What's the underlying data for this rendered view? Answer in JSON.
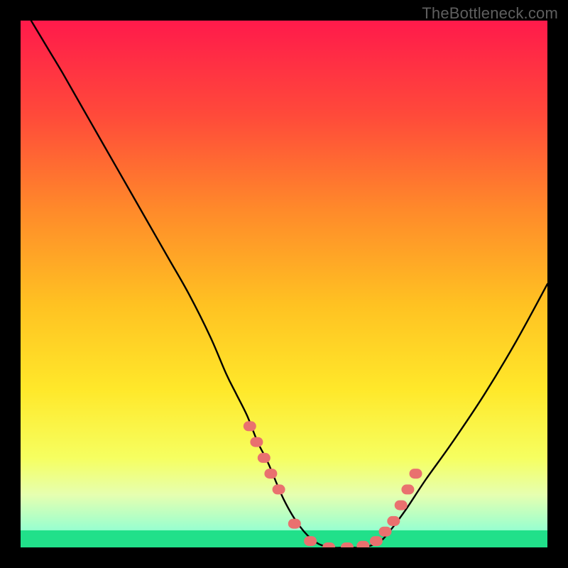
{
  "watermark": "TheBottleneck.com",
  "colors": {
    "gradient_stops": [
      {
        "offset": 0.0,
        "color": "#ff1a4b"
      },
      {
        "offset": 0.18,
        "color": "#ff4a3a"
      },
      {
        "offset": 0.36,
        "color": "#ff8a2a"
      },
      {
        "offset": 0.54,
        "color": "#ffc222"
      },
      {
        "offset": 0.7,
        "color": "#ffe82a"
      },
      {
        "offset": 0.83,
        "color": "#f6ff60"
      },
      {
        "offset": 0.9,
        "color": "#e6ffb0"
      },
      {
        "offset": 0.965,
        "color": "#9affcf"
      },
      {
        "offset": 1.0,
        "color": "#21e08a"
      }
    ],
    "curve": "#000000",
    "marker": "#e9716f",
    "bottom_band": "#21e08a"
  },
  "chart_data": {
    "type": "line",
    "title": "",
    "xlabel": "",
    "ylabel": "",
    "xlim": [
      0,
      100
    ],
    "ylim": [
      0,
      100
    ],
    "series": [
      {
        "name": "bottleneck-curve",
        "x": [
          2,
          5,
          8,
          12,
          16,
          20,
          24,
          28,
          32,
          36,
          39,
          41,
          43,
          45,
          47,
          50,
          53,
          56,
          59,
          62,
          65,
          68,
          70,
          73,
          77,
          82,
          88,
          94,
          100
        ],
        "y": [
          100,
          95,
          90,
          83,
          76,
          69,
          62,
          55,
          48,
          40,
          33,
          29,
          25,
          20,
          16,
          9,
          4,
          1,
          0,
          0,
          0,
          1,
          3,
          7,
          13,
          20,
          29,
          39,
          50
        ]
      }
    ],
    "markers": {
      "name": "highlight-points",
      "x": [
        43.5,
        44.8,
        46.2,
        47.5,
        49.0,
        52.0,
        55.0,
        58.5,
        62.0,
        65.0,
        67.5,
        69.2,
        70.8,
        72.2,
        73.5,
        75.0
      ],
      "y": [
        23,
        20,
        17,
        14,
        11,
        4.5,
        1.2,
        0,
        0,
        0.3,
        1.2,
        3,
        5,
        8,
        11,
        14
      ]
    }
  }
}
